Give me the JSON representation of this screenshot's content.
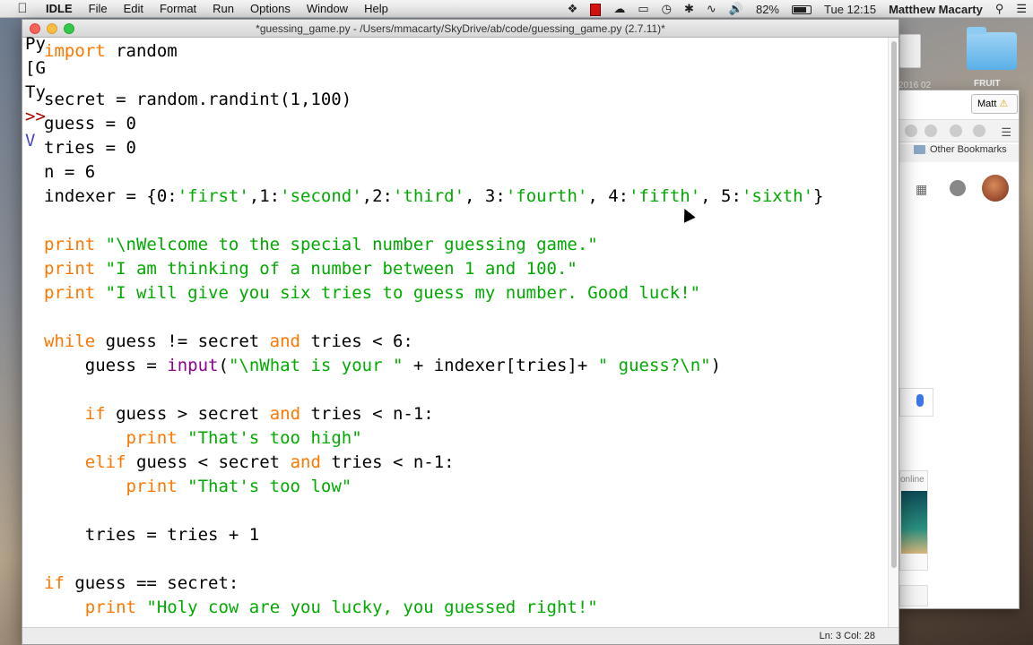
{
  "menubar": {
    "app": "IDLE",
    "items": [
      "File",
      "Edit",
      "Format",
      "Run",
      "Options",
      "Window",
      "Help"
    ],
    "battery": "82%",
    "time": "Tue 12:15",
    "user": "Matthew Macarty"
  },
  "desktop": {
    "label_a": "2016 02",
    "label_b": "FRUIT"
  },
  "chrome": {
    "profile": "Matt",
    "bookmarks_label": "Other Bookmarks",
    "thumb_text": "online"
  },
  "shell": {
    "lines": [
      "Py",
      "[G",
      "Ty",
      ">>",
      "V"
    ]
  },
  "idle": {
    "title": "*guessing_game.py - /Users/mmacarty/SkyDrive/ab/code/guessing_game.py (2.7.11)*",
    "status": "Ln: 3  Col: 28"
  },
  "code": [
    [
      [
        "kw",
        "import"
      ],
      [
        "n",
        " random"
      ]
    ],
    [],
    [
      [
        "n",
        "secret = random.randint(1,100)"
      ]
    ],
    [
      [
        "n",
        "guess = 0"
      ]
    ],
    [
      [
        "n",
        "tries = 0"
      ]
    ],
    [
      [
        "n",
        "n = 6"
      ]
    ],
    [
      [
        "n",
        "indexer = {0:"
      ],
      [
        "st",
        "'first'"
      ],
      [
        "n",
        ",1:"
      ],
      [
        "st",
        "'second'"
      ],
      [
        "n",
        ",2:"
      ],
      [
        "st",
        "'third'"
      ],
      [
        "n",
        ", 3:"
      ],
      [
        "st",
        "'fourth'"
      ],
      [
        "n",
        ", 4:"
      ],
      [
        "st",
        "'fifth'"
      ],
      [
        "n",
        ", 5:"
      ],
      [
        "st",
        "'sixth'"
      ],
      [
        "n",
        "}"
      ]
    ],
    [],
    [
      [
        "kw",
        "print"
      ],
      [
        "n",
        " "
      ],
      [
        "st",
        "\"\\nWelcome to the special number guessing game.\""
      ]
    ],
    [
      [
        "kw",
        "print"
      ],
      [
        "n",
        " "
      ],
      [
        "st",
        "\"I am thinking of a number between 1 and 100.\""
      ]
    ],
    [
      [
        "kw",
        "print"
      ],
      [
        "n",
        " "
      ],
      [
        "st",
        "\"I will give you six tries to guess my number. Good luck!\""
      ]
    ],
    [],
    [
      [
        "kw",
        "while"
      ],
      [
        "n",
        " guess != secret "
      ],
      [
        "kw",
        "and"
      ],
      [
        "n",
        " tries < 6:"
      ]
    ],
    [
      [
        "n",
        "    guess = "
      ],
      [
        "bi",
        "input"
      ],
      [
        "n",
        "("
      ],
      [
        "st",
        "\"\\nWhat is your \""
      ],
      [
        "n",
        " + indexer[tries]+ "
      ],
      [
        "st",
        "\" guess?\\n\""
      ],
      [
        "n",
        ")"
      ]
    ],
    [],
    [
      [
        "n",
        "    "
      ],
      [
        "kw",
        "if"
      ],
      [
        "n",
        " guess > secret "
      ],
      [
        "kw",
        "and"
      ],
      [
        "n",
        " tries < n-1:"
      ]
    ],
    [
      [
        "n",
        "        "
      ],
      [
        "kw",
        "print"
      ],
      [
        "n",
        " "
      ],
      [
        "st",
        "\"That's too high\""
      ]
    ],
    [
      [
        "n",
        "    "
      ],
      [
        "kw",
        "elif"
      ],
      [
        "n",
        " guess < secret "
      ],
      [
        "kw",
        "and"
      ],
      [
        "n",
        " tries < n-1:"
      ]
    ],
    [
      [
        "n",
        "        "
      ],
      [
        "kw",
        "print"
      ],
      [
        "n",
        " "
      ],
      [
        "st",
        "\"That's too low\""
      ]
    ],
    [],
    [
      [
        "n",
        "    tries = tries + 1"
      ]
    ],
    [],
    [
      [
        "kw",
        "if"
      ],
      [
        "n",
        " guess == secret:"
      ]
    ],
    [
      [
        "n",
        "    "
      ],
      [
        "kw",
        "print"
      ],
      [
        "n",
        " "
      ],
      [
        "st",
        "\"Holy cow are you lucky, you guessed right!\""
      ]
    ]
  ],
  "colors": {
    "keyword": "#ff7700",
    "string": "#00aa00",
    "builtin": "#900090"
  }
}
